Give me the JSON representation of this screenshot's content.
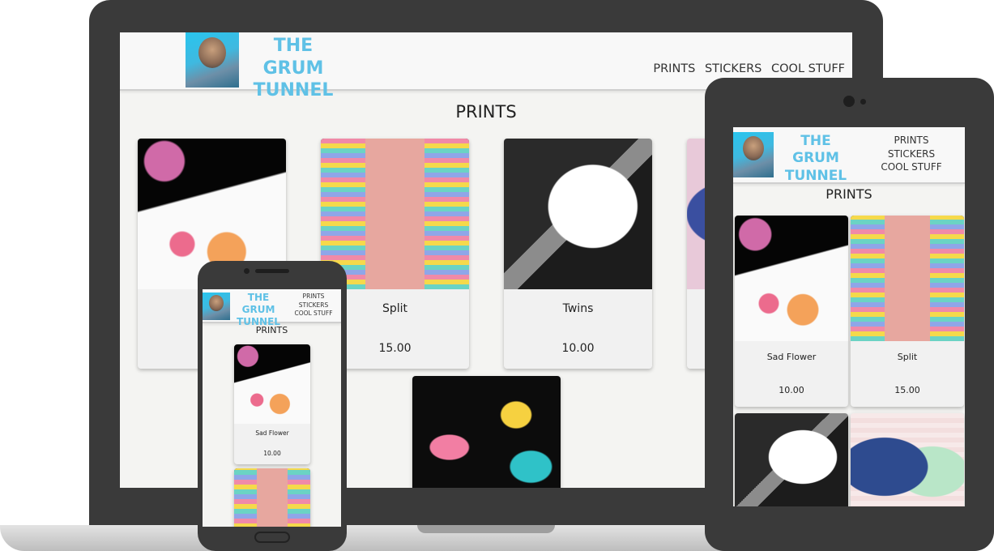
{
  "site": {
    "brand_line1": "THE GRUM",
    "brand_line2": "TUNNEL",
    "nav": [
      "PRINTS",
      "STICKERS",
      "COOL STUFF"
    ],
    "page_title": "PRINTS"
  },
  "products": [
    {
      "name": "Sad Flower",
      "price": "10.00"
    },
    {
      "name": "Split",
      "price": "15.00"
    },
    {
      "name": "Twins",
      "price": "10.00"
    }
  ],
  "laptop_card_1_partial_name": "Sad",
  "icons": {
    "logo": "diver-portrait-logo",
    "tablet_camera": "camera-icon",
    "phone_home": "home-button-icon"
  },
  "colors": {
    "brand": "#5fc1e6",
    "device_frame": "#3a3a3a",
    "screen_bg": "#f4f4f2"
  }
}
